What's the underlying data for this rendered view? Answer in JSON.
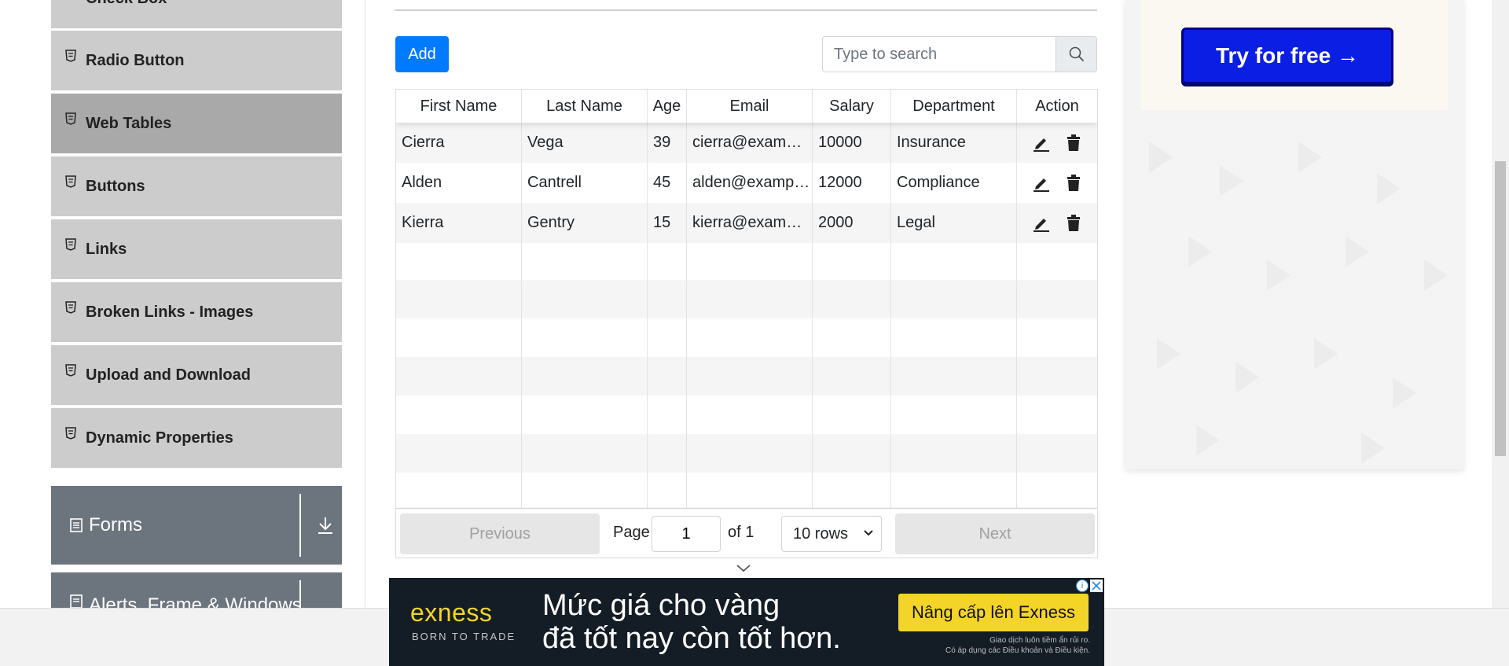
{
  "sidebar": {
    "items": [
      {
        "label": "Check Box"
      },
      {
        "label": "Radio Button"
      },
      {
        "label": "Web Tables"
      },
      {
        "label": "Buttons"
      },
      {
        "label": "Links"
      },
      {
        "label": "Broken Links - Images"
      },
      {
        "label": "Upload and Download"
      },
      {
        "label": "Dynamic Properties"
      }
    ],
    "groups": [
      {
        "label": "Forms"
      },
      {
        "label": "Alerts, Frame & Windows"
      }
    ]
  },
  "toolbar": {
    "add_label": "Add",
    "search_placeholder": "Type to search"
  },
  "table": {
    "headers": [
      "First Name",
      "Last Name",
      "Age",
      "Email",
      "Salary",
      "Department",
      "Action"
    ],
    "rows": [
      [
        "Cierra",
        "Vega",
        "39",
        "cierra@example.com",
        "10000",
        "Insurance"
      ],
      [
        "Alden",
        "Cantrell",
        "45",
        "alden@example.com",
        "12000",
        "Compliance"
      ],
      [
        "Kierra",
        "Gentry",
        "15",
        "kierra@example.com",
        "2000",
        "Legal"
      ]
    ],
    "empty_rows": 7
  },
  "pagination": {
    "previous_label": "Previous",
    "page_label": "Page",
    "page_value": "1",
    "of_label": "of 1",
    "rows_label": "10 rows",
    "next_label": "Next"
  },
  "right_ad": {
    "cta": "Try for free →"
  },
  "bottom_ad": {
    "logo": "exness",
    "tagline": "BORN TO TRADE",
    "headline_line1": "Mức giá cho vàng",
    "headline_line2": "đã tốt nay còn tốt hơn.",
    "cta": "Nâng cấp lên Exness",
    "fine_line1": "Giao dịch luôn tiềm ẩn rủi ro.",
    "fine_line2": "Có áp dụng các Điều khoản và Điều kiện."
  },
  "colors": {
    "primary": "#007bff",
    "sidebar_item": "#cccccc",
    "sidebar_active": "#a9a9a9",
    "group_header": "#6c757d",
    "ad_button": "#0a1fe3",
    "exness_yellow": "#f5d42a"
  }
}
